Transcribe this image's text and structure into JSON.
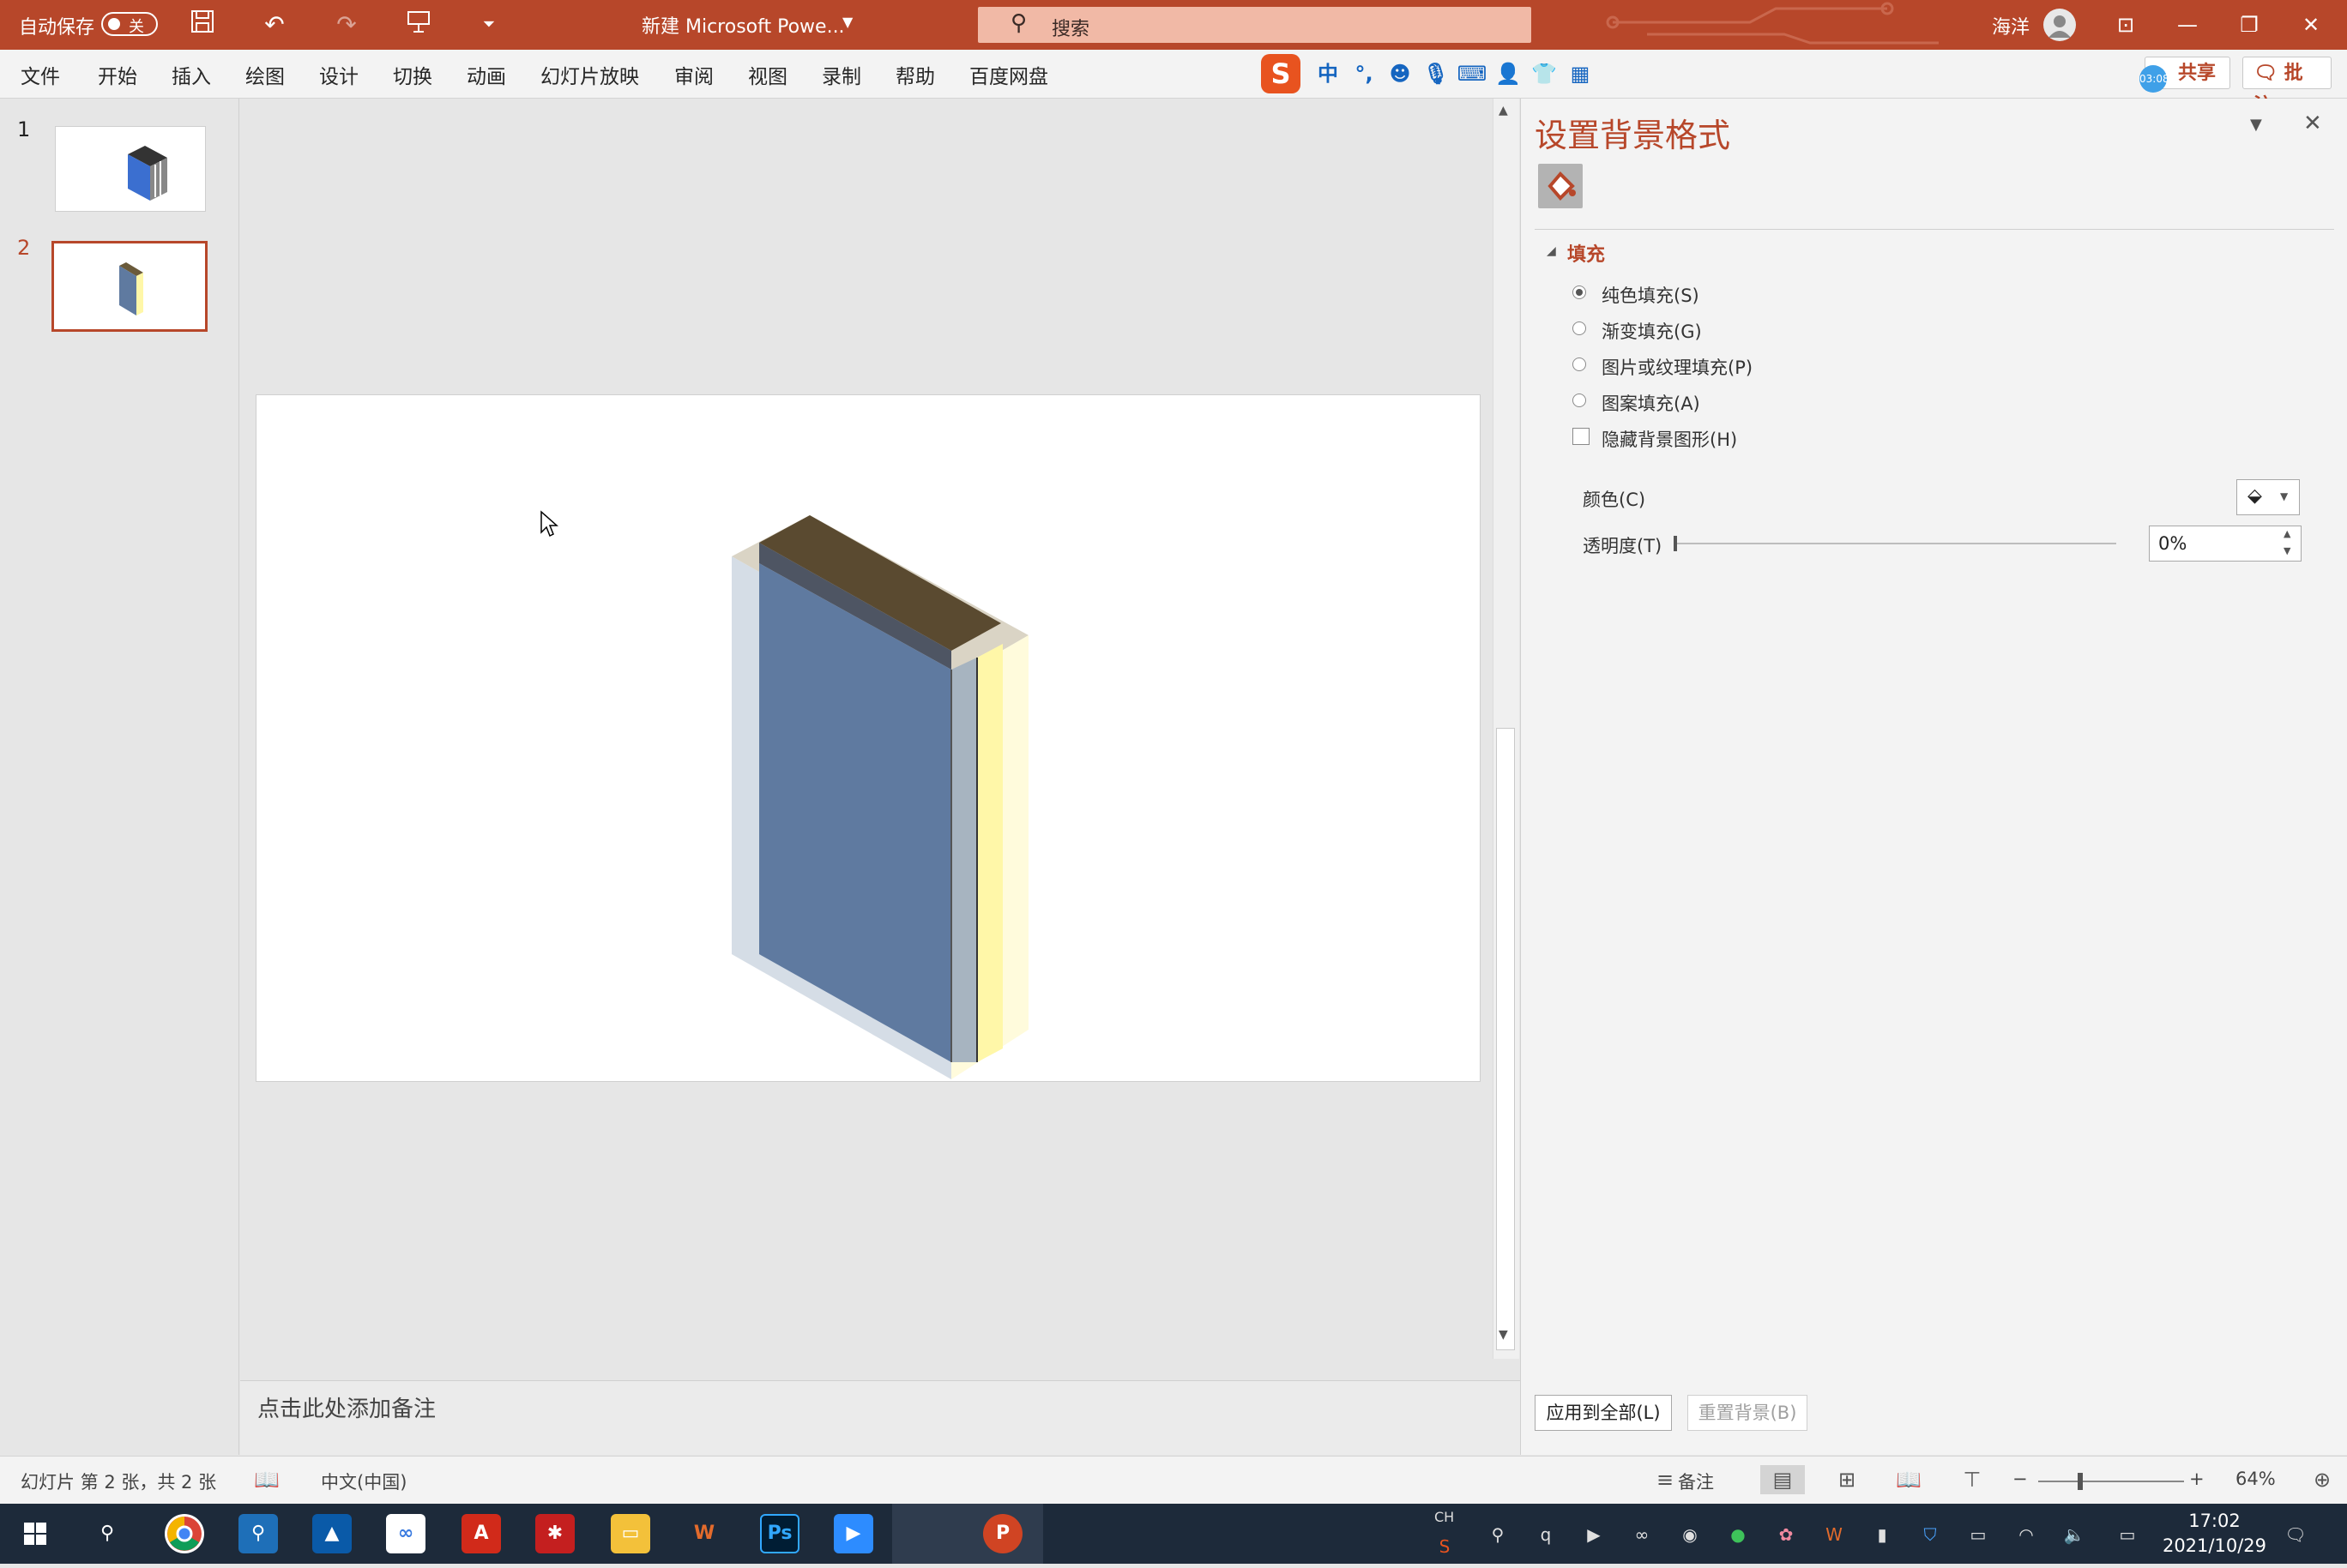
{
  "titlebar": {
    "autosave_label": "自动保存",
    "autosave_state": "关",
    "doc_title": "新建 Microsoft Powe...",
    "search_placeholder": "搜索",
    "user_name": "海洋"
  },
  "menubar": {
    "items": [
      "文件",
      "开始",
      "插入",
      "绘图",
      "设计",
      "切换",
      "动画",
      "幻灯片放映",
      "审阅",
      "视图",
      "录制",
      "帮助",
      "百度网盘"
    ],
    "ime": [
      "中",
      "°,"
    ],
    "share_label": "共享",
    "comment_label": "批注",
    "timer_badge": "03:08"
  },
  "thumbnails": {
    "slides": [
      {
        "number": "1"
      },
      {
        "number": "2"
      }
    ]
  },
  "notes": {
    "placeholder": "点击此处添加备注"
  },
  "panel": {
    "title": "设置背景格式",
    "section": "填充",
    "fill_options": [
      "纯色填充(S)",
      "渐变填充(G)",
      "图片或纹理填充(P)",
      "图案填充(A)"
    ],
    "selected_index": 0,
    "hide_bg_graphics": "隐藏背景图形(H)",
    "color_label": "颜色(C)",
    "transparency_label": "透明度(T)",
    "transparency_value": "0%",
    "apply_all": "应用到全部(L)",
    "reset_bg": "重置背景(B)"
  },
  "statusbar": {
    "slide_info": "幻灯片 第 2 张，共 2 张",
    "language": "中文(中国)",
    "notes_label": "备注",
    "zoom": "64%"
  },
  "taskbar": {
    "ps_label": "Ps",
    "lang": "CH",
    "time": "17:02",
    "date": "2021/10/29"
  },
  "colors": {
    "accent": "#b7472a",
    "book_cover": "#5f7aa0",
    "book_pages": "#fff7a8"
  }
}
